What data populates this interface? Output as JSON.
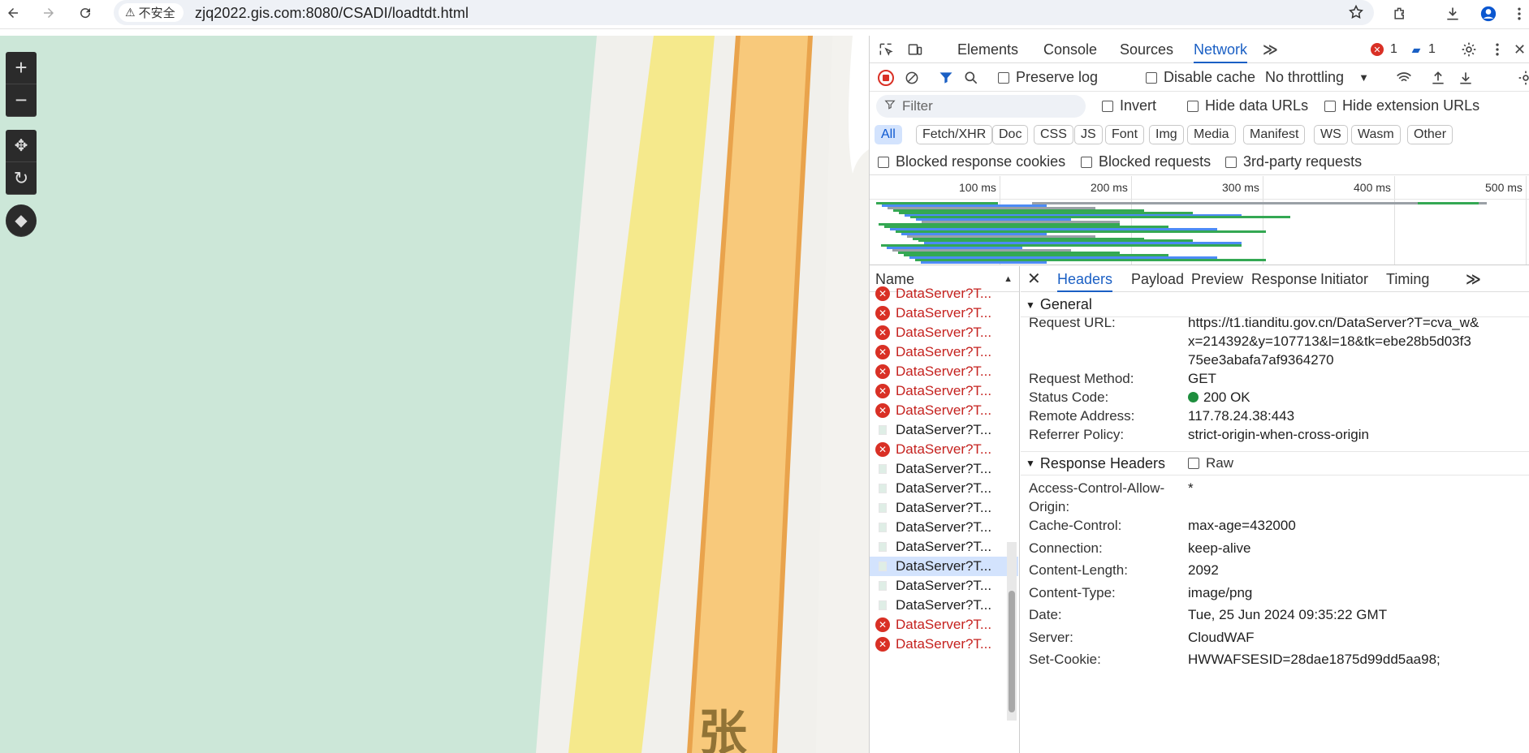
{
  "browser": {
    "security_label": "不安全",
    "url": "zjq2022.gis.com:8080/CSADI/loadtdt.html"
  },
  "devtools": {
    "tabs": [
      "Elements",
      "Console",
      "Sources",
      "Network"
    ],
    "active_tab": "Network",
    "error_count": "1",
    "message_count": "1",
    "toolbar": {
      "preserve_log": "Preserve log",
      "disable_cache": "Disable cache",
      "throttling": "No throttling"
    },
    "filter": {
      "placeholder": "Filter",
      "invert": "Invert",
      "hide_data_urls": "Hide data URLs",
      "hide_extension_urls": "Hide extension URLs"
    },
    "type_filters": [
      "All",
      "Fetch/XHR",
      "Doc",
      "CSS",
      "JS",
      "Font",
      "Img",
      "Media",
      "Manifest",
      "WS",
      "Wasm",
      "Other"
    ],
    "blocked": {
      "cookies": "Blocked response cookies",
      "requests": "Blocked requests",
      "third_party": "3rd-party requests"
    },
    "timeline_ticks": [
      "100 ms",
      "200 ms",
      "300 ms",
      "400 ms",
      "500 ms"
    ],
    "list": {
      "header": "Name",
      "rows": [
        {
          "name": "DataServer?T...",
          "status": "error"
        },
        {
          "name": "DataServer?T...",
          "status": "error"
        },
        {
          "name": "DataServer?T...",
          "status": "error"
        },
        {
          "name": "DataServer?T...",
          "status": "error"
        },
        {
          "name": "DataServer?T...",
          "status": "error"
        },
        {
          "name": "DataServer?T...",
          "status": "error"
        },
        {
          "name": "DataServer?T...",
          "status": "error"
        },
        {
          "name": "DataServer?T...",
          "status": "ok"
        },
        {
          "name": "DataServer?T...",
          "status": "error"
        },
        {
          "name": "DataServer?T...",
          "status": "ok"
        },
        {
          "name": "DataServer?T...",
          "status": "ok"
        },
        {
          "name": "DataServer?T...",
          "status": "ok"
        },
        {
          "name": "DataServer?T...",
          "status": "ok"
        },
        {
          "name": "DataServer?T...",
          "status": "ok"
        },
        {
          "name": "DataServer?T...",
          "status": "selected"
        },
        {
          "name": "DataServer?T...",
          "status": "ok"
        },
        {
          "name": "DataServer?T...",
          "status": "ok"
        },
        {
          "name": "DataServer?T...",
          "status": "error"
        },
        {
          "name": "DataServer?T...",
          "status": "error"
        }
      ]
    },
    "detail_tabs": [
      "Headers",
      "Payload",
      "Preview",
      "Response",
      "Initiator",
      "Timing"
    ],
    "general": {
      "title": "General",
      "request_url_label": "Request URL:",
      "request_url_lines": [
        "https://t1.tianditu.gov.cn/DataServer?T=cva_w&",
        "x=214392&y=107713&l=18&tk=ebe28b5d03f3",
        "75ee3abafa7af9364270"
      ],
      "method_label": "Request Method:",
      "method": "GET",
      "status_label": "Status Code:",
      "status": "200 OK",
      "remote_label": "Remote Address:",
      "remote": "117.78.24.38:443",
      "referrer_label": "Referrer Policy:",
      "referrer": "strict-origin-when-cross-origin"
    },
    "response_headers": {
      "title": "Response Headers",
      "raw_label": "Raw",
      "items": [
        {
          "key": "Access-Control-Allow-Origin:",
          "value": "*"
        },
        {
          "key": "Cache-Control:",
          "value": "max-age=432000"
        },
        {
          "key": "Connection:",
          "value": "keep-alive"
        },
        {
          "key": "Content-Length:",
          "value": "2092"
        },
        {
          "key": "Content-Type:",
          "value": "image/png"
        },
        {
          "key": "Date:",
          "value": "Tue, 25 Jun 2024 09:35:22 GMT"
        },
        {
          "key": "Server:",
          "value": "CloudWAF"
        },
        {
          "key": "Set-Cookie:",
          "value": "HWWAFSESID=28dae1875d99dd5aa98;"
        }
      ]
    }
  },
  "colors": {
    "accent": "#1a5fc4",
    "error": "#d93025",
    "ok_dot": "#1e8e3e"
  }
}
